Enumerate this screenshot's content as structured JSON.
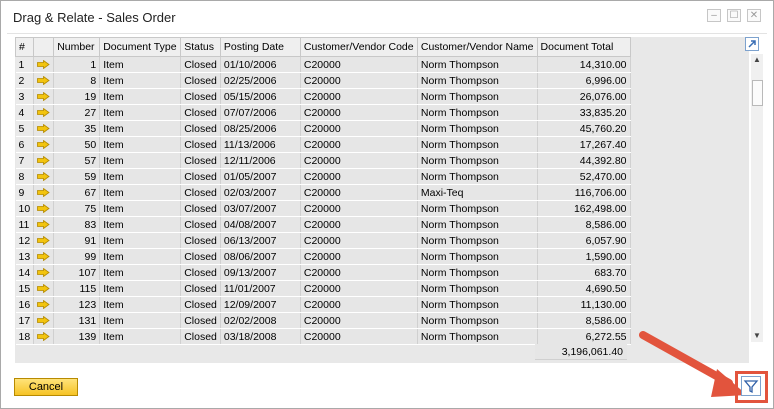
{
  "window": {
    "title": "Drag & Relate - Sales Order",
    "minimize_glyph": "–",
    "maximize_glyph": "☐",
    "close_glyph": "✕"
  },
  "grid": {
    "columns": [
      "#",
      "",
      "Number",
      "Document Type",
      "Status",
      "Posting Date",
      "Customer/Vendor Code",
      "Customer/Vendor Name",
      "Document Total"
    ],
    "rows": [
      [
        "1",
        "1",
        "Item",
        "Closed",
        "01/10/2006",
        "C20000",
        "Norm Thompson",
        "14,310.00"
      ],
      [
        "2",
        "8",
        "Item",
        "Closed",
        "02/25/2006",
        "C20000",
        "Norm Thompson",
        "6,996.00"
      ],
      [
        "3",
        "19",
        "Item",
        "Closed",
        "05/15/2006",
        "C20000",
        "Norm Thompson",
        "26,076.00"
      ],
      [
        "4",
        "27",
        "Item",
        "Closed",
        "07/07/2006",
        "C20000",
        "Norm Thompson",
        "33,835.20"
      ],
      [
        "5",
        "35",
        "Item",
        "Closed",
        "08/25/2006",
        "C20000",
        "Norm Thompson",
        "45,760.20"
      ],
      [
        "6",
        "50",
        "Item",
        "Closed",
        "11/13/2006",
        "C20000",
        "Norm Thompson",
        "17,267.40"
      ],
      [
        "7",
        "57",
        "Item",
        "Closed",
        "12/11/2006",
        "C20000",
        "Norm Thompson",
        "44,392.80"
      ],
      [
        "8",
        "59",
        "Item",
        "Closed",
        "01/05/2007",
        "C20000",
        "Norm Thompson",
        "52,470.00"
      ],
      [
        "9",
        "67",
        "Item",
        "Closed",
        "02/03/2007",
        "C20000",
        "Maxi-Teq",
        "116,706.00"
      ],
      [
        "10",
        "75",
        "Item",
        "Closed",
        "03/07/2007",
        "C20000",
        "Norm Thompson",
        "162,498.00"
      ],
      [
        "11",
        "83",
        "Item",
        "Closed",
        "04/08/2007",
        "C20000",
        "Norm Thompson",
        "8,586.00"
      ],
      [
        "12",
        "91",
        "Item",
        "Closed",
        "06/13/2007",
        "C20000",
        "Norm Thompson",
        "6,057.90"
      ],
      [
        "13",
        "99",
        "Item",
        "Closed",
        "08/06/2007",
        "C20000",
        "Norm Thompson",
        "1,590.00"
      ],
      [
        "14",
        "107",
        "Item",
        "Closed",
        "09/13/2007",
        "C20000",
        "Norm Thompson",
        "683.70"
      ],
      [
        "15",
        "115",
        "Item",
        "Closed",
        "11/01/2007",
        "C20000",
        "Norm Thompson",
        "4,690.50"
      ],
      [
        "16",
        "123",
        "Item",
        "Closed",
        "12/09/2007",
        "C20000",
        "Norm Thompson",
        "11,130.00"
      ],
      [
        "17",
        "131",
        "Item",
        "Closed",
        "02/02/2008",
        "C20000",
        "Norm Thompson",
        "8,586.00"
      ],
      [
        "18",
        "139",
        "Item",
        "Closed",
        "03/18/2008",
        "C20000",
        "Norm Thompson",
        "6,272.55"
      ]
    ],
    "total": "3,196,061.40"
  },
  "footer": {
    "cancel_label": "Cancel"
  },
  "icons": {
    "link_arrow": "link-arrow-icon",
    "expand": "expand-icon",
    "filter": "filter-icon"
  },
  "colors": {
    "link_arrow": "#f2c40f",
    "cancel_button": "#f6c325",
    "highlight": "#e2543d"
  }
}
